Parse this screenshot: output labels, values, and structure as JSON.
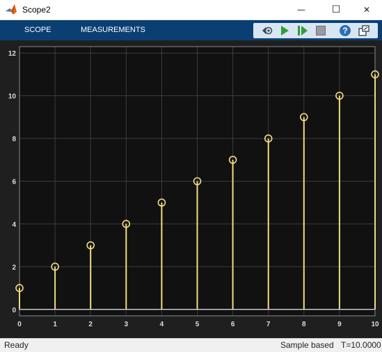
{
  "window": {
    "title": "Scope2",
    "minimize_glyph": "—",
    "maximize_glyph": "☐",
    "close_glyph": "✕",
    "app_icon": "matlab-logo-icon"
  },
  "toolstrip": {
    "tabs": [
      {
        "label": "SCOPE"
      },
      {
        "label": "MEASUREMENTS"
      }
    ],
    "buttons": [
      {
        "name": "stepping-options-icon"
      },
      {
        "name": "run-icon"
      },
      {
        "name": "step-forward-icon"
      },
      {
        "name": "stop-icon"
      },
      {
        "name": "help-icon"
      },
      {
        "name": "undock-icon"
      }
    ]
  },
  "colors": {
    "toolstrip": "#0b3f74",
    "plot_bg": "#111111",
    "frame_bg": "#1f1f1f",
    "series": "#f2dc82",
    "grid": "#3c3c3c",
    "tick_text": "#dcdcdc"
  },
  "chart_data": {
    "type": "stem",
    "x": [
      0,
      1,
      2,
      3,
      4,
      5,
      6,
      7,
      8,
      9,
      10
    ],
    "y": [
      1,
      2,
      3,
      4,
      5,
      6,
      7,
      8,
      9,
      10,
      11
    ],
    "xlim": [
      0,
      10
    ],
    "ylim": [
      -0.3,
      12.3
    ],
    "xticks": [
      "0",
      "1",
      "2",
      "3",
      "4",
      "5",
      "6",
      "7",
      "8",
      "9",
      "10"
    ],
    "yticks": [
      "0",
      "2",
      "4",
      "6",
      "8",
      "10",
      "12"
    ],
    "grid": true,
    "marker": "circle"
  },
  "status": {
    "left": "Ready",
    "mode": "Sample based",
    "time": "T=10.0000"
  }
}
